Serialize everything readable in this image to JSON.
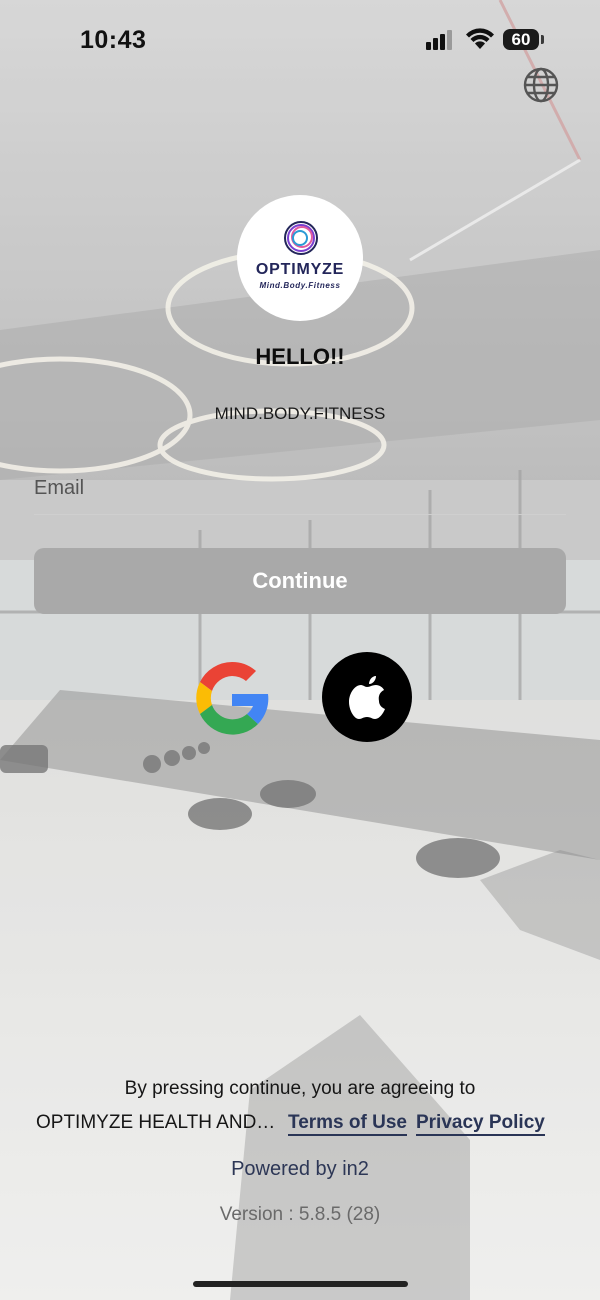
{
  "status_bar": {
    "time": "10:43",
    "battery": "60",
    "icons": [
      "cellular-signal-icon",
      "wifi-icon",
      "battery-icon"
    ]
  },
  "header": {
    "language_icon": "globe-icon"
  },
  "logo": {
    "word": "OPTIMYZE",
    "tagline": "Mind.Body.Fitness"
  },
  "greeting": {
    "title": "HELLO!!",
    "subtitle": "MIND.BODY.FITNESS"
  },
  "form": {
    "email_placeholder": "Email",
    "email_value": "",
    "continue_label": "Continue"
  },
  "social": {
    "google_icon": "google-icon",
    "apple_icon": "apple-icon"
  },
  "footer": {
    "agree_text": "By pressing continue, you are agreeing to",
    "org_name": "OPTIMYZE HEALTH AND FI...",
    "terms_label": "Terms of Use",
    "privacy_label": "Privacy Policy",
    "powered_by": "Powered by in2",
    "version": "Version : 5.8.5 (28)"
  },
  "colors": {
    "brand": "#23265a",
    "link": "#2a3556",
    "button_disabled": "#a9a9a9"
  }
}
